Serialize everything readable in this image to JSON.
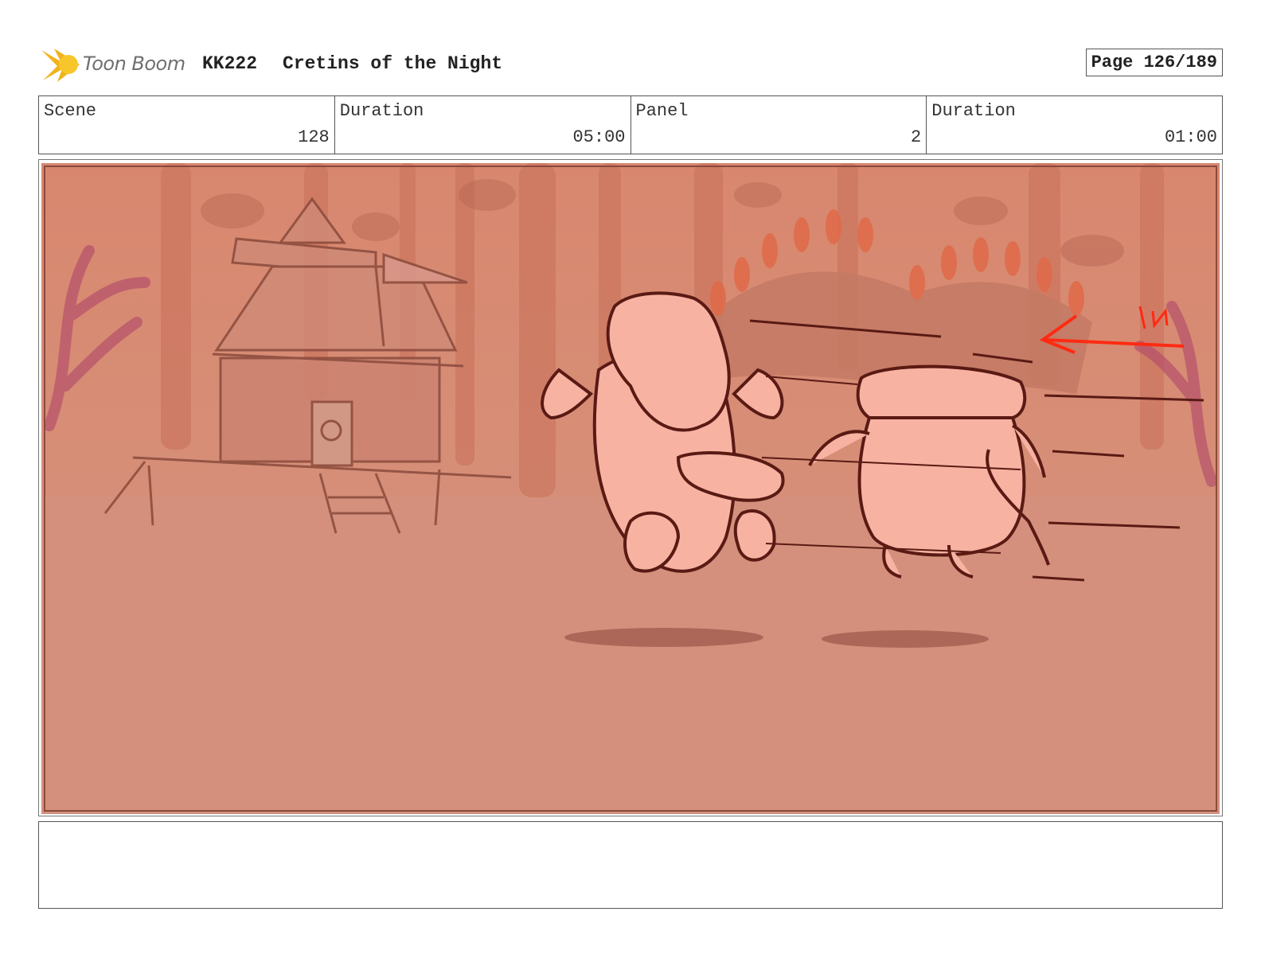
{
  "header": {
    "logo_text": "Toon Boom",
    "production_code": "KK222",
    "episode_title": "Cretins of the Night",
    "page_label": "Page 126/189"
  },
  "info": {
    "scene_label": "Scene",
    "scene_value": "128",
    "scene_duration_label": "Duration",
    "scene_duration_value": "05:00",
    "panel_label": "Panel",
    "panel_value": "2",
    "panel_duration_label": "Duration",
    "panel_duration_value": "01:00"
  },
  "panel": {
    "annotation_text": "IN"
  },
  "notes": {
    "text": ""
  },
  "colors": {
    "sky": "#d98e78",
    "ground": "#d4907c",
    "sketch_line": "#5a1a14",
    "character_fill": "#f7b2a2",
    "annotation_red": "#ff2a12"
  }
}
